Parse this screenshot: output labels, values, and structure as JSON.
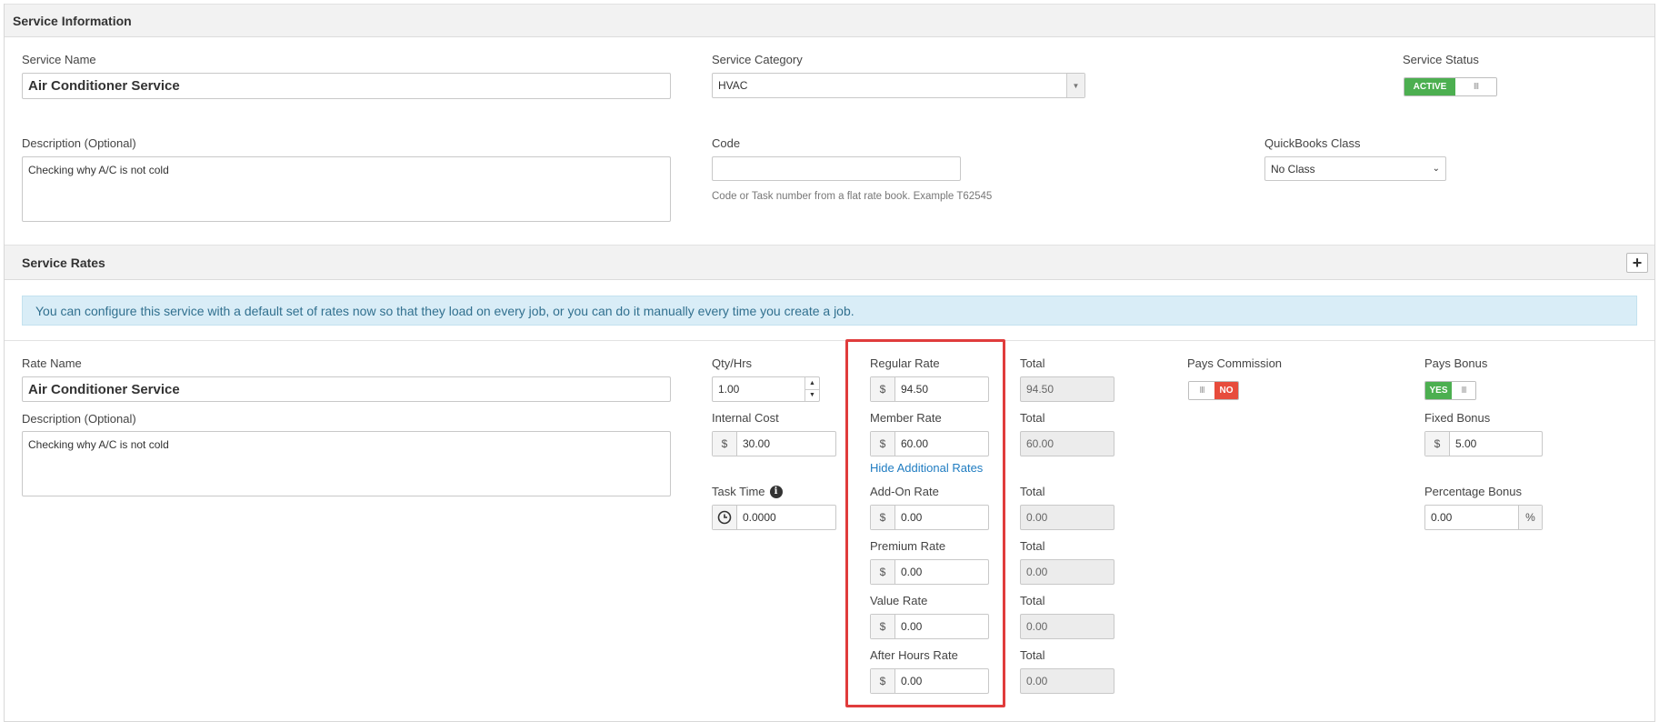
{
  "service_info": {
    "header": "Service Information",
    "service_name_label": "Service Name",
    "service_name_value": "Air Conditioner Service",
    "category_label": "Service Category",
    "category_value": "HVAC",
    "status_label": "Service Status",
    "status_toggle_text": "ACTIVE",
    "status_toggle_grip": "III",
    "description_label": "Description (Optional)",
    "description_value": "Checking why A/C is not cold",
    "code_label": "Code",
    "code_value": "",
    "code_hint": "Code or Task number from a flat rate book. Example T62545",
    "qb_class_label": "QuickBooks Class",
    "qb_class_value": "No Class"
  },
  "service_rates": {
    "header": "Service Rates",
    "add_button": "+",
    "info_message": "You can configure this service with a default set of rates now so that they load on every job, or you can do it manually every time you create a job.",
    "rate_name_label": "Rate Name",
    "rate_name_value": "Air Conditioner Service",
    "description_label": "Description (Optional)",
    "description_value": "Checking why A/C is not cold",
    "qty_label": "Qty/Hrs",
    "qty_value": "1.00",
    "internal_cost_label": "Internal Cost",
    "internal_cost_value": "30.00",
    "task_time_label": "Task Time",
    "task_time_value": "0.0000",
    "currency_symbol": "$",
    "hide_link": "Hide Additional Rates",
    "total_label": "Total",
    "rates": [
      {
        "label": "Regular Rate",
        "value": "94.50",
        "total": "94.50"
      },
      {
        "label": "Member Rate",
        "value": "60.00",
        "total": "60.00"
      },
      {
        "label": "Add-On Rate",
        "value": "0.00",
        "total": "0.00"
      },
      {
        "label": "Premium Rate",
        "value": "0.00",
        "total": "0.00"
      },
      {
        "label": "Value Rate",
        "value": "0.00",
        "total": "0.00"
      },
      {
        "label": "After Hours Rate",
        "value": "0.00",
        "total": "0.00"
      }
    ],
    "pays_commission_label": "Pays Commission",
    "pays_commission_value": "NO",
    "pays_bonus_label": "Pays Bonus",
    "pays_bonus_value": "YES",
    "toggle_grip": "III",
    "fixed_bonus_label": "Fixed Bonus",
    "fixed_bonus_value": "5.00",
    "percentage_bonus_label": "Percentage Bonus",
    "percentage_bonus_value": "0.00",
    "percent_symbol": "%"
  },
  "colors": {
    "active_green": "#4caf50",
    "no_red": "#e74c3c",
    "highlight_border": "#e03c3c",
    "info_bg": "#d9edf7",
    "link_blue": "#1f7cc1"
  }
}
